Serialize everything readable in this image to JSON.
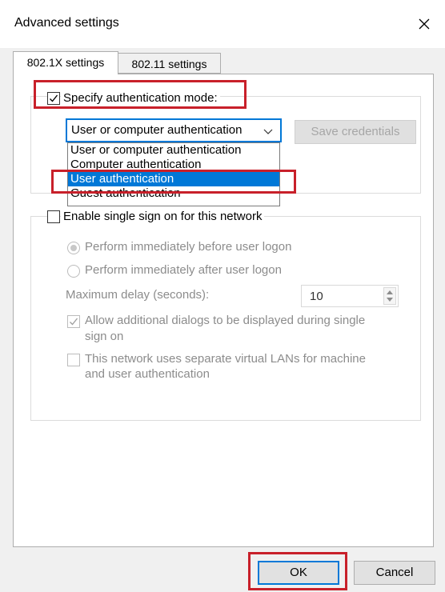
{
  "window": {
    "title": "Advanced settings"
  },
  "tabs": [
    {
      "label": "802.1X settings",
      "active": true
    },
    {
      "label": "802.11 settings",
      "active": false
    }
  ],
  "auth_mode": {
    "checkbox_label": "Specify authentication mode:",
    "checked": true,
    "dropdown_value": "User or computer authentication",
    "options": [
      "User or computer authentication",
      "Computer authentication",
      "User authentication",
      "Guest authentication"
    ],
    "highlighted_option": "User authentication",
    "save_credentials_label": "Save credentials"
  },
  "sso": {
    "checkbox_label": "Enable single sign on for this network",
    "checked": false,
    "radio_before": "Perform immediately before user logon",
    "radio_after": "Perform immediately after user logon",
    "max_delay_label": "Maximum delay (seconds):",
    "max_delay_value": "10",
    "allow_dialogs_label_line1": "Allow additional dialogs to be displayed during single",
    "allow_dialogs_label_line2": "sign on",
    "vlan_label_line1": "This network uses separate virtual LANs for machine",
    "vlan_label_line2": "and user authentication"
  },
  "buttons": {
    "ok": "OK",
    "cancel": "Cancel"
  },
  "colors": {
    "accent": "#0078d7",
    "highlight_box": "#c8202a"
  }
}
